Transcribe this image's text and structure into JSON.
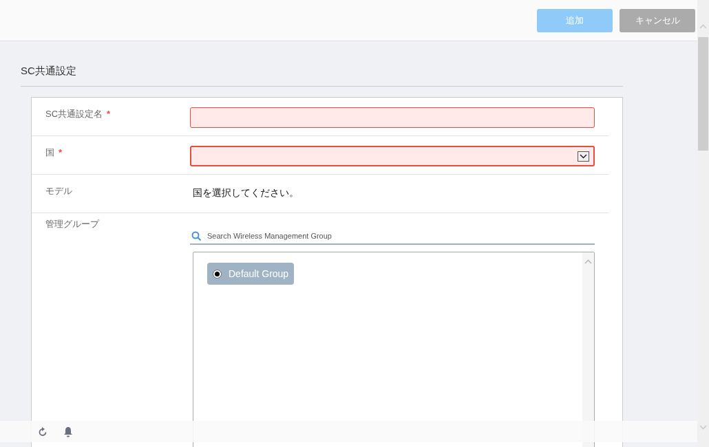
{
  "header": {
    "buttons": [
      {
        "label": "追加",
        "kind": "primary",
        "disabled": true
      },
      {
        "label": "キャンセル",
        "kind": "secondary",
        "disabled": false
      }
    ]
  },
  "section": {
    "title": "SC共通設定"
  },
  "required_mark": "*",
  "fields": [
    {
      "kind": "text",
      "label": "SC共通設定名",
      "required": true,
      "invalid": true
    },
    {
      "kind": "select",
      "label": "国",
      "required": true,
      "invalid": true
    },
    {
      "kind": "static",
      "label": "モデル",
      "required": false,
      "value": "国を選択してください。"
    },
    {
      "kind": "group_picker",
      "label": "管理グループ",
      "required": false,
      "search": {
        "placeholder": "Search Wireless Management Group"
      },
      "groups": [
        {
          "label": "Default Group",
          "selected": true
        }
      ]
    }
  ]
}
